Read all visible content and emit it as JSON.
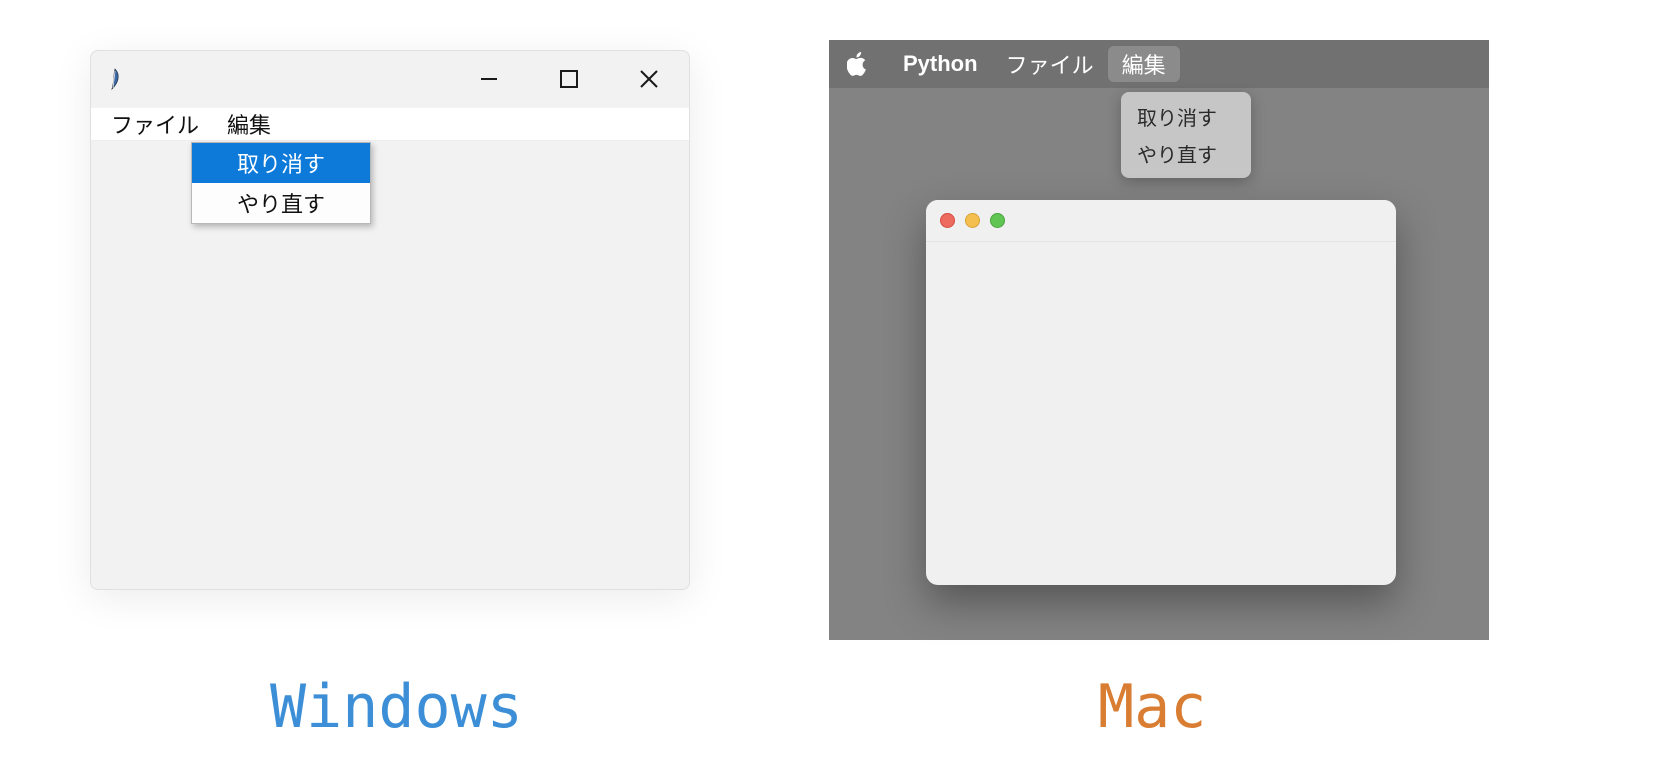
{
  "labels": {
    "windows": "Windows",
    "mac": "Mac"
  },
  "windows": {
    "app_icon": "feather-icon",
    "menubar": [
      {
        "id": "file",
        "label": "ファイル"
      },
      {
        "id": "edit",
        "label": "編集"
      }
    ],
    "open_menu": "edit",
    "dropdown": [
      {
        "id": "undo",
        "label": "取り消す",
        "highlighted": true
      },
      {
        "id": "redo",
        "label": "やり直す",
        "highlighted": false
      }
    ]
  },
  "mac": {
    "app_name": "Python",
    "menubar": [
      {
        "id": "file",
        "label": "ファイル",
        "highlighted": false
      },
      {
        "id": "edit",
        "label": "編集",
        "highlighted": true
      }
    ],
    "open_menu": "edit",
    "dropdown": [
      {
        "id": "undo",
        "label": "取り消す"
      },
      {
        "id": "redo",
        "label": "やり直す"
      }
    ]
  }
}
